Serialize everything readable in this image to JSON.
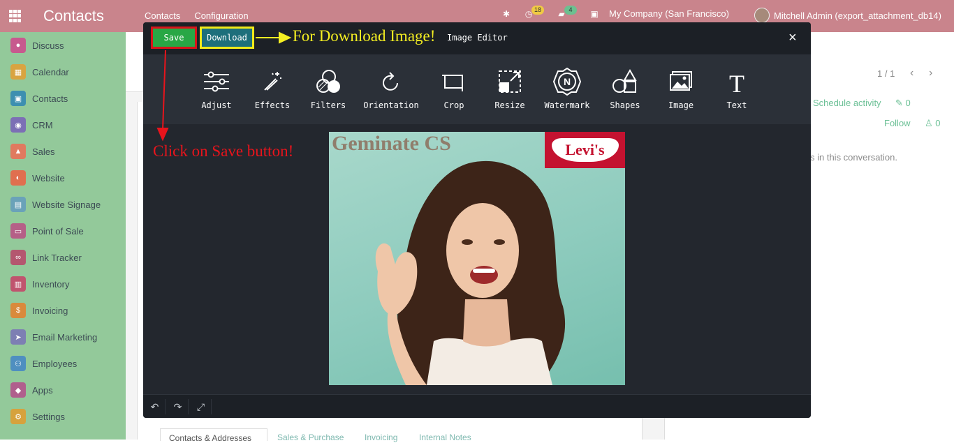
{
  "navbar": {
    "app_title": "Contacts",
    "menu": [
      "Contacts",
      "Configuration"
    ],
    "activity_badge": "18",
    "message_badge": "4",
    "company": "My Company (San Francisco)",
    "user": "Mitchell Admin (export_attachment_db14)"
  },
  "sidebar": {
    "items": [
      {
        "label": "Discuss",
        "icon": "discuss-icon",
        "color": "#c75a8e"
      },
      {
        "label": "Calendar",
        "icon": "calendar-icon",
        "color": "#d9a441"
      },
      {
        "label": "Contacts",
        "icon": "contacts-icon",
        "color": "#3d8fb0"
      },
      {
        "label": "CRM",
        "icon": "crm-icon",
        "color": "#7c6fb5"
      },
      {
        "label": "Sales",
        "icon": "sales-icon",
        "color": "#e07a5f"
      },
      {
        "label": "Website",
        "icon": "website-icon",
        "color": "#e06f4f"
      },
      {
        "label": "Website Signage",
        "icon": "signage-icon",
        "color": "#6aa2b9"
      },
      {
        "label": "Point of Sale",
        "icon": "pos-icon",
        "color": "#b55f87"
      },
      {
        "label": "Link Tracker",
        "icon": "link-icon",
        "color": "#b4576f"
      },
      {
        "label": "Inventory",
        "icon": "inventory-icon",
        "color": "#c0546e"
      },
      {
        "label": "Invoicing",
        "icon": "invoicing-icon",
        "color": "#d98a3c"
      },
      {
        "label": "Email Marketing",
        "icon": "email-marketing-icon",
        "color": "#7d7fb3"
      },
      {
        "label": "Employees",
        "icon": "employees-icon",
        "color": "#4f8fc0"
      },
      {
        "label": "Apps",
        "icon": "apps-icon",
        "color": "#b05f8d"
      },
      {
        "label": "Settings",
        "icon": "settings-icon",
        "color": "#d6a23d"
      }
    ]
  },
  "background": {
    "pager": "1 / 1",
    "schedule_activity": "Schedule activity",
    "attachments_count": "0",
    "follow": "Follow",
    "followers_count": "0",
    "conversation_note": "s in this conversation.",
    "tabs": [
      "Contacts & Addresses",
      "Sales & Purchase",
      "Invoicing",
      "Internal Notes"
    ]
  },
  "editor": {
    "title": "Image Editor",
    "save_label": "Save",
    "download_label": "Download",
    "close_label": "×",
    "tools": [
      {
        "label": "Adjust",
        "icon": "adjust-icon"
      },
      {
        "label": "Effects",
        "icon": "effects-icon"
      },
      {
        "label": "Filters",
        "icon": "filters-icon"
      },
      {
        "label": "Orientation",
        "icon": "orientation-icon"
      },
      {
        "label": "Crop",
        "icon": "crop-icon"
      },
      {
        "label": "Resize",
        "icon": "resize-icon"
      },
      {
        "label": "Watermark",
        "icon": "watermark-icon"
      },
      {
        "label": "Shapes",
        "icon": "shapes-icon"
      },
      {
        "label": "Image",
        "icon": "image-icon"
      },
      {
        "label": "Text",
        "icon": "text-icon"
      }
    ],
    "image_watermark_text": "Geminate CS",
    "image_logo_text": "Levi's",
    "footer": [
      "undo-icon",
      "redo-icon",
      "fullscreen-icon"
    ]
  },
  "annotations": {
    "download_hint": "For Download Image!",
    "save_hint": "Click on Save button!"
  },
  "colors": {
    "navbar": "#c9848c",
    "sidebar": "#93c99a",
    "save_button": "#28a745",
    "download_button": "#1d6f7b",
    "save_highlight": "#d8141a",
    "download_highlight": "#f0ea1a"
  }
}
